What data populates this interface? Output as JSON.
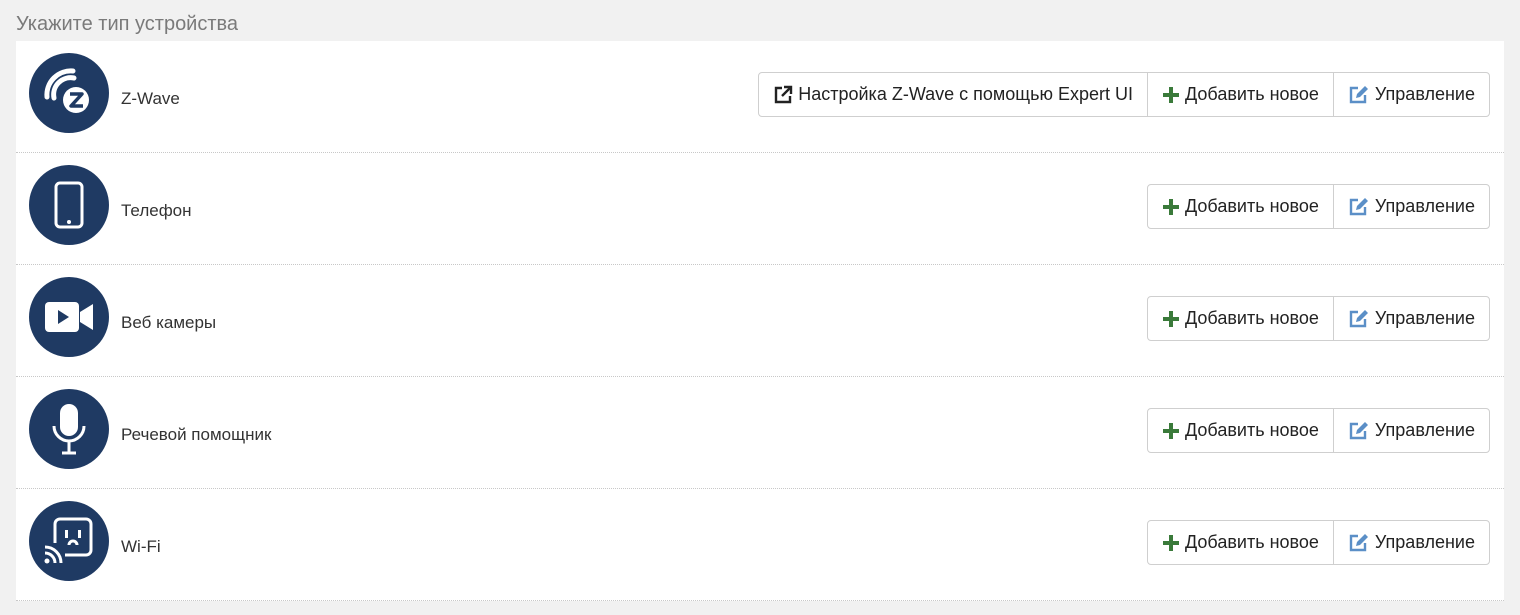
{
  "page": {
    "title": "Укажите тип устройства"
  },
  "colors": {
    "icon_bg": "#1f3a63",
    "add_icon": "#3a7a3a",
    "edit_icon": "#5b8fc7"
  },
  "devices": [
    {
      "label": "Z-Wave",
      "icon": "zwave-icon",
      "expert_label": "Настройка Z-Wave с помощью Expert UI",
      "add_label": "Добавить новое",
      "manage_label": "Управление"
    },
    {
      "label": "Телефон",
      "icon": "phone-icon",
      "add_label": "Добавить новое",
      "manage_label": "Управление"
    },
    {
      "label": "Веб камеры",
      "icon": "camera-icon",
      "add_label": "Добавить новое",
      "manage_label": "Управление"
    },
    {
      "label": "Речевой помощник",
      "icon": "microphone-icon",
      "add_label": "Добавить новое",
      "manage_label": "Управление"
    },
    {
      "label": "Wi-Fi",
      "icon": "wifi-socket-icon",
      "add_label": "Добавить новое",
      "manage_label": "Управление"
    }
  ]
}
